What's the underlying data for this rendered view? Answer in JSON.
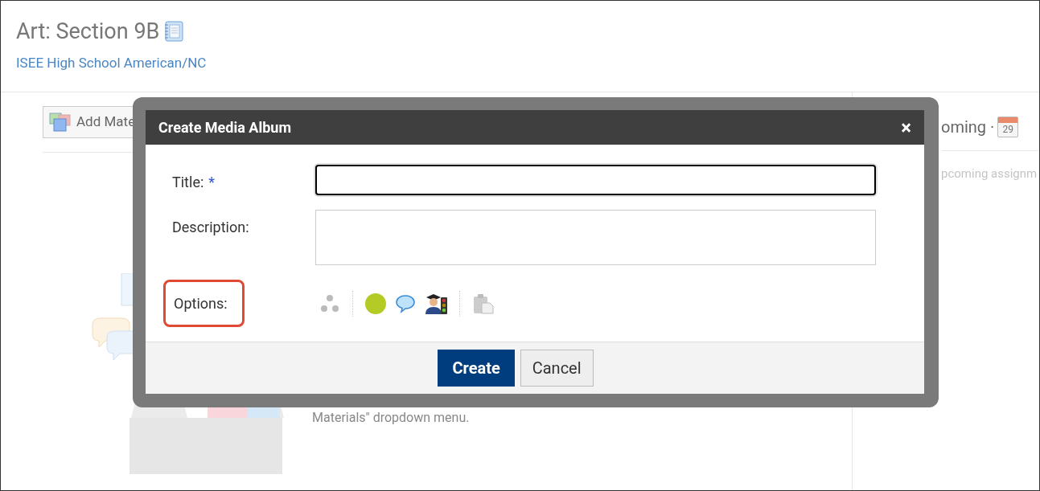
{
  "page": {
    "title": "Art: Section 9B",
    "subtitle": "ISEE High School American/NC"
  },
  "toolbar": {
    "add_button": "Add Mate"
  },
  "upcoming": {
    "heading": "oming ·",
    "calendar_day": "29",
    "empty_text": "pcoming assignm"
  },
  "materials_hint": "Materials\" dropdown menu.",
  "dialog": {
    "title": "Create Media Album",
    "close": "×",
    "fields": [
      {
        "label": "Title:",
        "required_mark": "*",
        "kind": "input",
        "focused": true
      },
      {
        "label": "Description:",
        "kind": "textarea",
        "focused": false
      }
    ],
    "options": {
      "label": "Options:",
      "highlighted": true
    },
    "buttons": [
      {
        "label": "Create",
        "primary": true
      },
      {
        "label": "Cancel",
        "primary": false
      }
    ]
  }
}
